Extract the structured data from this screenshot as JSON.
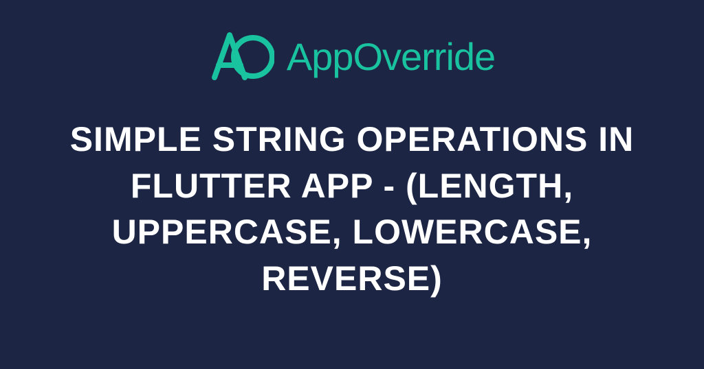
{
  "brand": {
    "name": "AppOverride",
    "accent_color": "#19c3a0"
  },
  "title": "Simple String Operations in Flutter App - (Length, UpperCase, Lowercase, Reverse)",
  "background_color": "#1d2544"
}
